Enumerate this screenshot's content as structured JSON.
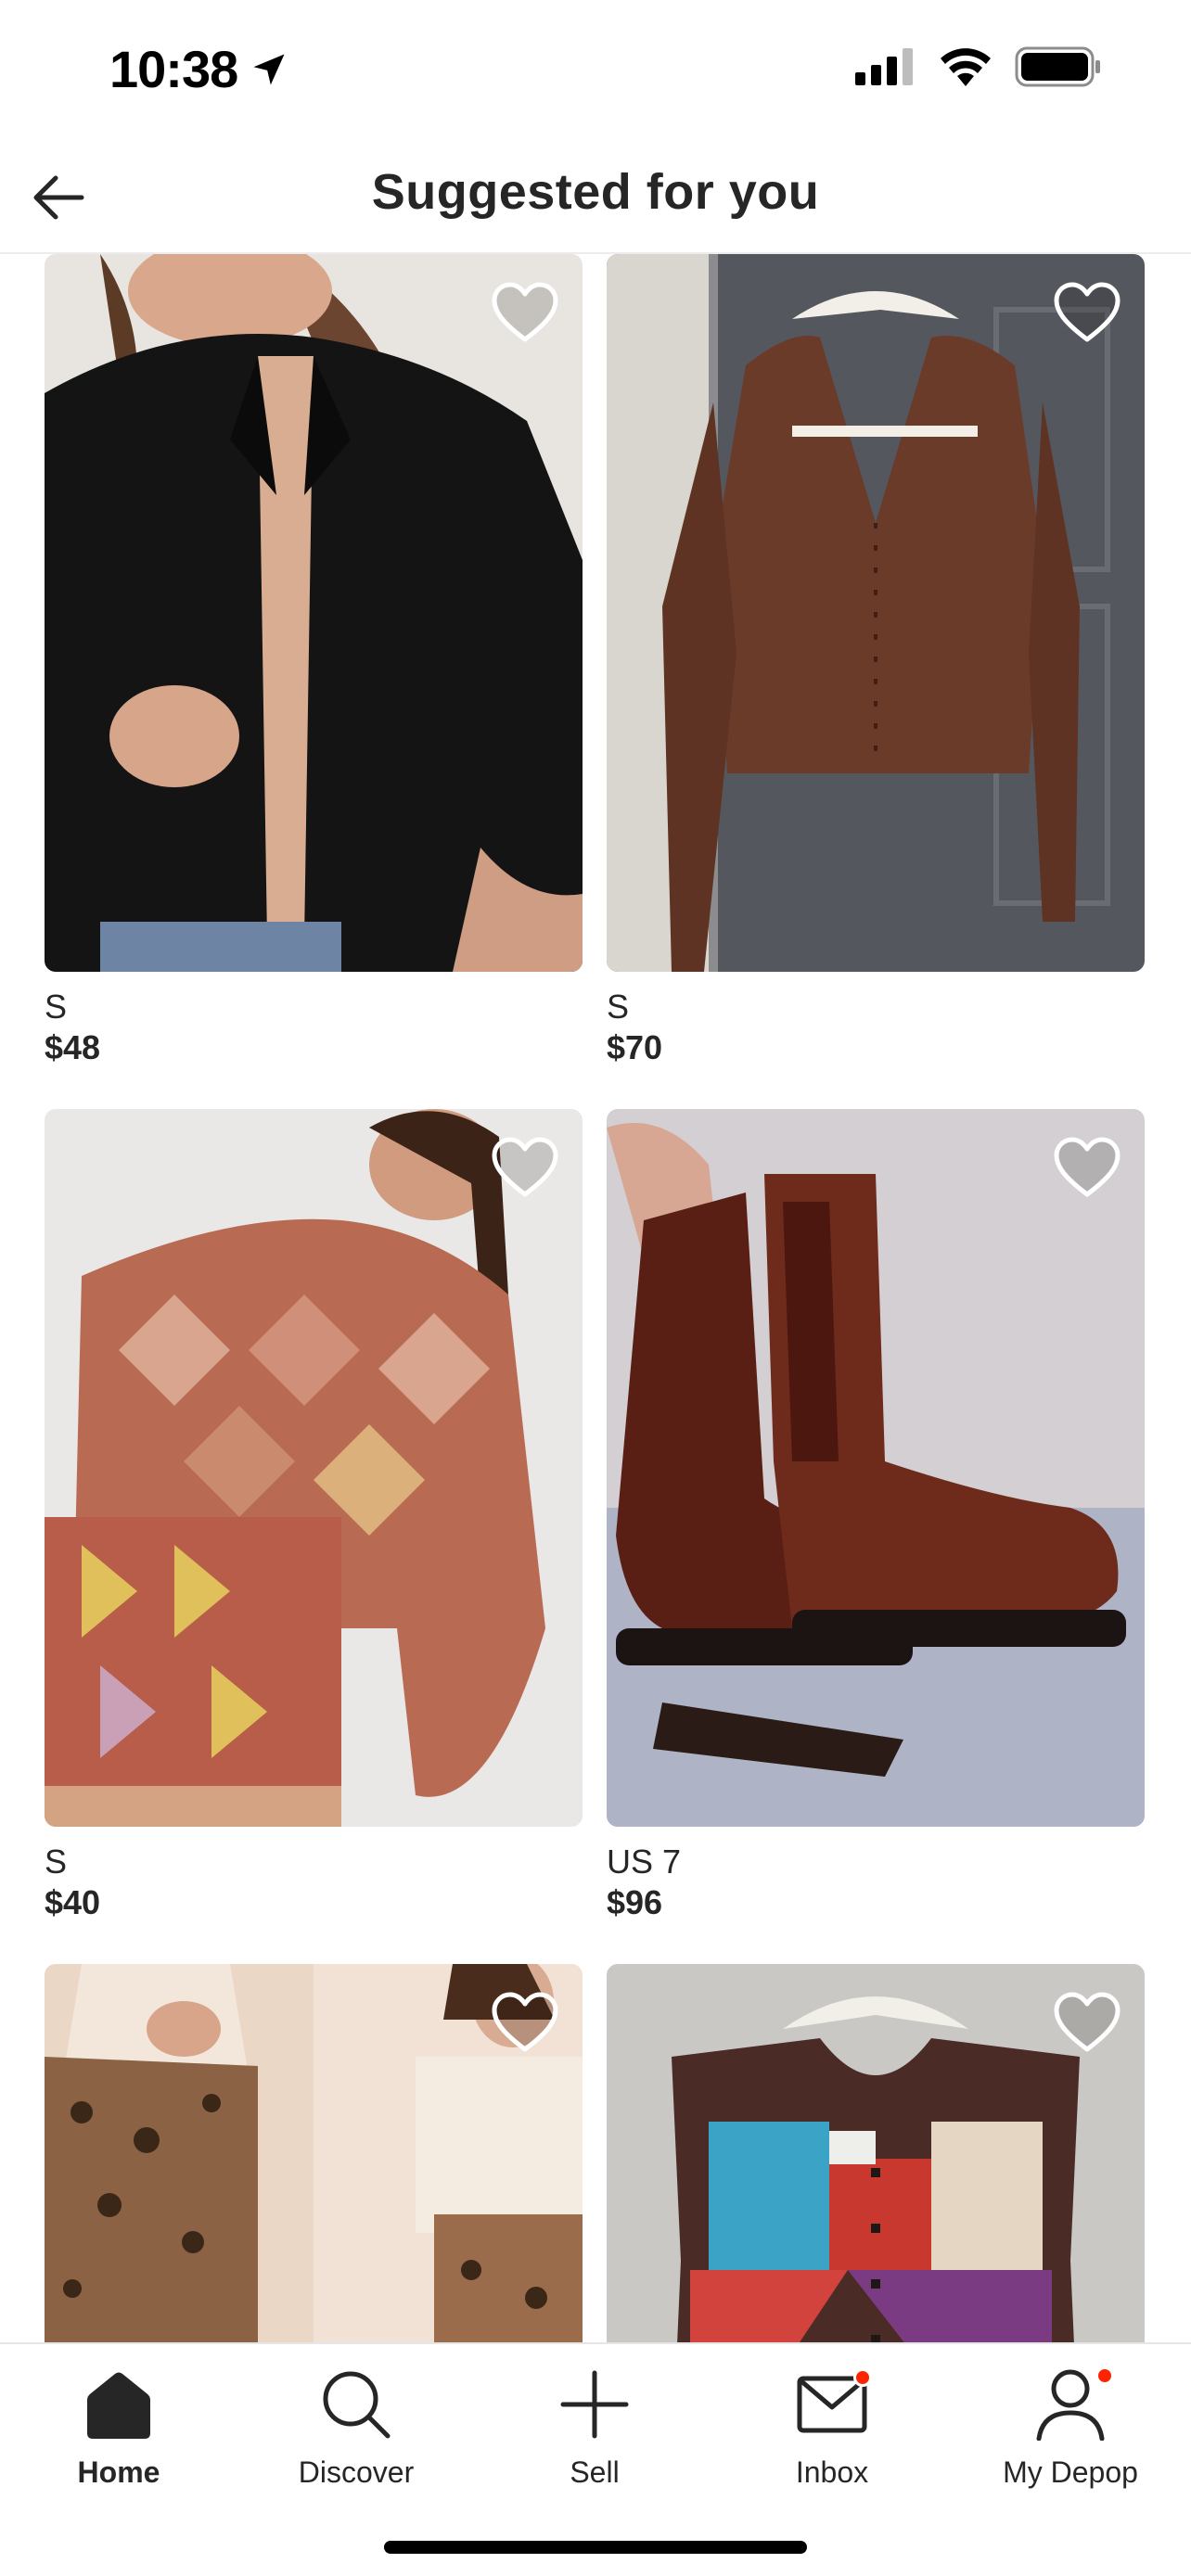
{
  "status_bar": {
    "time": "10:38"
  },
  "header": {
    "title": "Suggested for you"
  },
  "products": [
    {
      "size": "S",
      "price": "$48"
    },
    {
      "size": "S",
      "price": "$70"
    },
    {
      "size": "S",
      "price": "$40"
    },
    {
      "size": "US 7",
      "price": "$96"
    },
    {
      "size": "",
      "price": ""
    },
    {
      "size": "",
      "price": ""
    }
  ],
  "tab_bar": {
    "home": "Home",
    "discover": "Discover",
    "sell": "Sell",
    "inbox": "Inbox",
    "my_depop": "My Depop"
  },
  "colors": {
    "accent_badge": "#ff2300",
    "text": "#262626"
  }
}
